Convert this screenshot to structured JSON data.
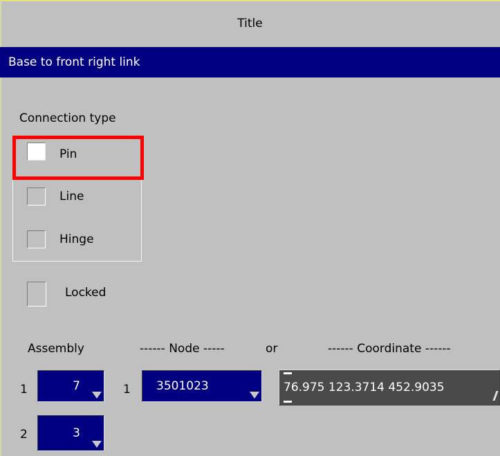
{
  "header": {
    "title": "Title"
  },
  "name_field": {
    "value": "Base to front right link"
  },
  "connection": {
    "heading": "Connection type",
    "options": [
      {
        "label": "Pin",
        "checked": true,
        "highlighted": true
      },
      {
        "label": "Line",
        "checked": false
      },
      {
        "label": "Hinge",
        "checked": false
      }
    ]
  },
  "locked": {
    "label": "Locked",
    "checked": false
  },
  "columns": {
    "assembly": "Assembly",
    "node": "------ Node -----",
    "or": "or",
    "coordinate": "------ Coordinate ------"
  },
  "rows": [
    {
      "index": "1",
      "assembly": "7",
      "node_index": "1",
      "node": "3501023",
      "coordinate": "76.975  123.3714  452.9035"
    },
    {
      "index": "2",
      "assembly": "3"
    }
  ],
  "colors": {
    "panel": "#c0c0c0",
    "field": "#000080",
    "highlight": "#ff0000",
    "coordinate_field": "#4a4a4a"
  }
}
